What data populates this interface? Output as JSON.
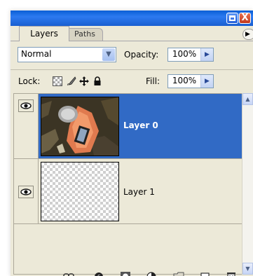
{
  "panel": {
    "tabs": [
      {
        "label": "Layers",
        "active": true
      },
      {
        "label": "Paths",
        "active": false
      }
    ],
    "window_buttons": {
      "minimize": "minimize-icon",
      "close": "close-icon"
    },
    "close_glyph": "X"
  },
  "blend": {
    "value": "Normal"
  },
  "opacity": {
    "label": "Opacity:",
    "value": "100%"
  },
  "lock": {
    "label": "Lock:",
    "icons": [
      "lock-transparent-icon",
      "lock-image-icon",
      "lock-position-icon",
      "lock-all-icon"
    ]
  },
  "fill": {
    "label": "Fill:",
    "value": "100%"
  },
  "layers": [
    {
      "name": "Layer 0",
      "selected": true,
      "visible": true,
      "thumbnail": "photo-bottle-thumbnail"
    },
    {
      "name": "Layer 1",
      "selected": false,
      "visible": true,
      "thumbnail": "transparent-thumbnail"
    }
  ],
  "toolbar_icons": [
    "link-layers-icon",
    "layer-style-icon",
    "layer-mask-icon",
    "adjustment-layer-icon",
    "new-group-icon",
    "new-layer-icon",
    "delete-layer-icon"
  ],
  "colors": {
    "selection": "#316ac5",
    "panel_bg": "#ece9d8",
    "titlebar": "#2c7af0"
  }
}
